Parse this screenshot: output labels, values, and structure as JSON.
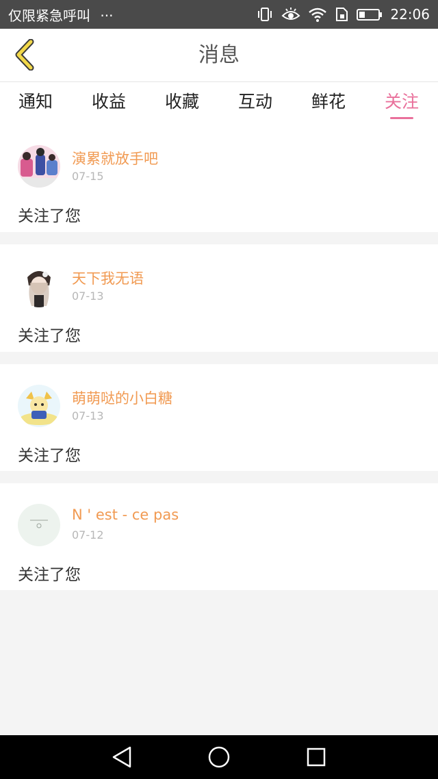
{
  "status_bar": {
    "left_text": "仅限紧急呼叫",
    "dots": "···",
    "time": "22:06"
  },
  "header": {
    "title": "消息"
  },
  "tabs": [
    {
      "label": "通知"
    },
    {
      "label": "收益"
    },
    {
      "label": "收藏"
    },
    {
      "label": "互动"
    },
    {
      "label": "鲜花"
    },
    {
      "label": "关注"
    }
  ],
  "active_tab": "关注",
  "messages": [
    {
      "username": "演累就放手吧",
      "date": "07-15",
      "text": "关注了您"
    },
    {
      "username": "天下我无语",
      "date": "07-13",
      "text": "关注了您"
    },
    {
      "username": "萌萌哒的小白糖",
      "date": "07-13",
      "text": "关注了您"
    },
    {
      "username": "N ' est - ce pas",
      "date": "07-12",
      "text": "关注了您"
    }
  ],
  "colors": {
    "accent": "#e9709b",
    "username": "#f19a52",
    "back_arrow": "#f2d84a"
  },
  "icons": {
    "back": "back-arrow-icon",
    "nav_back": "triangle-back-icon",
    "nav_home": "circle-home-icon",
    "nav_recent": "square-recent-icon"
  }
}
